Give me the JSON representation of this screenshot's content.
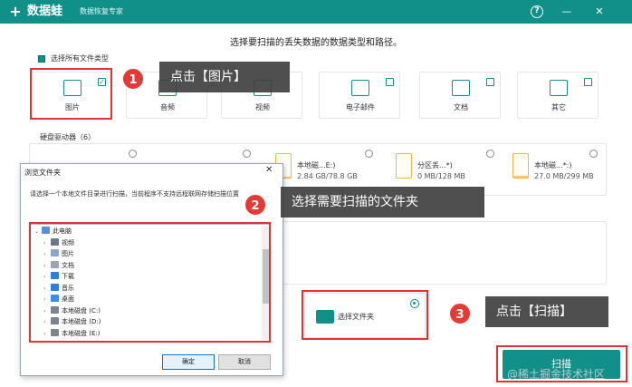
{
  "app": {
    "logo_glyph": "+",
    "name": "数据蛙",
    "subtitle": "数据恢复专家"
  },
  "titlebar": {
    "help_glyph": "?",
    "minimize_glyph": "—",
    "close_glyph": "✕"
  },
  "prompt": "选择要扫描的丢失数据的数据类型和路径。",
  "select_all_label": "选择所有文件类型",
  "file_types": [
    {
      "label": "图片",
      "checked": true
    },
    {
      "label": "音频",
      "checked": false
    },
    {
      "label": "视频",
      "checked": false
    },
    {
      "label": "电子邮件",
      "checked": false
    },
    {
      "label": "文档",
      "checked": false
    },
    {
      "label": "其它",
      "checked": false
    }
  ],
  "checkbox_checked_glyph": "✓",
  "disk_section_label": "硬盘驱动器（6）",
  "drives": [
    {
      "name": "本地磁...E:)",
      "size": "2.84 GB/78.8 GB",
      "fill": 0.04
    },
    {
      "name": "分区丢...*)",
      "size": "0 MB/128 MB",
      "fill": 0.0
    },
    {
      "name": "本地磁...*:)",
      "size": "27.0 MB/299 MB",
      "fill": 0.09
    }
  ],
  "folder_option_label": "选择文件夹",
  "scan_button_label": "扫描",
  "watermark": "@稀土掘金技术社区",
  "dialog": {
    "title": "浏览文件夹",
    "close_glyph": "✕",
    "description": "请选择一个本地文件目录进行扫描，当前程序不支持远程联网存储扫描位置",
    "tree": [
      {
        "label": "此电脑",
        "twisty": "⌄",
        "indent": 0,
        "color": "#5b8fd6"
      },
      {
        "label": "视频",
        "twisty": "›",
        "indent": 1,
        "color": "#6d7a86"
      },
      {
        "label": "图片",
        "twisty": "›",
        "indent": 1,
        "color": "#8aa6c8"
      },
      {
        "label": "文档",
        "twisty": "›",
        "indent": 1,
        "color": "#9aa5b1"
      },
      {
        "label": "下载",
        "twisty": "›",
        "indent": 1,
        "color": "#2f7fd8"
      },
      {
        "label": "音乐",
        "twisty": "›",
        "indent": 1,
        "color": "#2f7fd8"
      },
      {
        "label": "桌面",
        "twisty": "›",
        "indent": 1,
        "color": "#3a8ee6"
      },
      {
        "label": "本地磁盘 (C:)",
        "twisty": "›",
        "indent": 1,
        "color": "#7a8590"
      },
      {
        "label": "本地磁盘 (D:)",
        "twisty": "›",
        "indent": 1,
        "color": "#7a8590"
      },
      {
        "label": "本地磁盘 (E:)",
        "twisty": "›",
        "indent": 1,
        "color": "#7a8590"
      }
    ],
    "ok_label": "确定",
    "cancel_label": "取消"
  },
  "callouts": [
    {
      "number": "1",
      "text": "点击【图片】"
    },
    {
      "number": "2",
      "text": "选择需要扫描的文件夹"
    },
    {
      "number": "3",
      "text": "点击【扫描】"
    }
  ],
  "colors": {
    "accent": "#11908a",
    "highlight": "#e03434",
    "callout_bg": "#404040"
  }
}
